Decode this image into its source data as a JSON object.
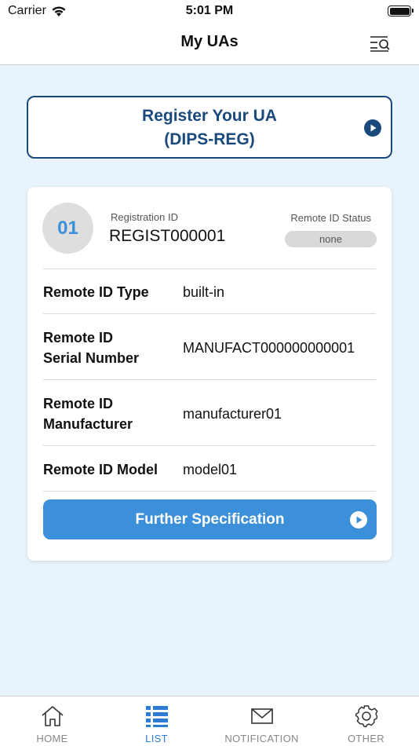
{
  "status_bar": {
    "carrier": "Carrier",
    "time": "5:01 PM"
  },
  "header": {
    "title": "My UAs",
    "menu_icon": "filter-search-icon"
  },
  "register": {
    "line1": "Register Your UA",
    "line2": "(DIPS-REG)"
  },
  "ua_card": {
    "index": "01",
    "registration_id_label": "Registration ID",
    "registration_id": "REGIST000001",
    "remote_id_status_label": "Remote ID Status",
    "remote_id_status": "none",
    "rows": [
      {
        "label": "Remote ID Type",
        "value": "built-in"
      },
      {
        "label_line1": "Remote ID",
        "label_line2": "Serial Number",
        "value": "MANUFACT000000000001"
      },
      {
        "label_line1": "Remote ID",
        "label_line2": "Manufacturer",
        "value": "manufacturer01"
      },
      {
        "label": "Remote ID Model",
        "value": "model01"
      }
    ],
    "further_button": "Further Specification"
  },
  "tabs": [
    {
      "label": "HOME",
      "icon": "home-icon"
    },
    {
      "label": "LIST",
      "icon": "list-icon",
      "active": true
    },
    {
      "label": "NOTIFICATION",
      "icon": "mail-icon"
    },
    {
      "label": "OTHER",
      "icon": "gear-icon"
    }
  ],
  "colors": {
    "background": "#e8f4fc",
    "navy": "#1a4a7c",
    "accent": "#3c8fd9",
    "active_tab": "#2b7cd3"
  }
}
